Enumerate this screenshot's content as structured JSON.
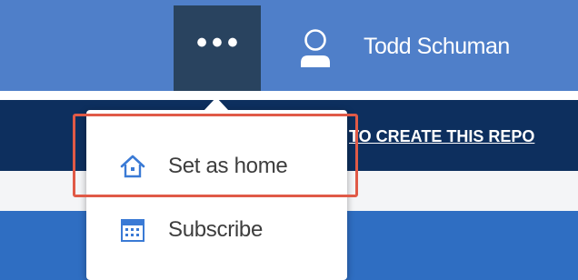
{
  "header": {
    "more_label": "•••",
    "user_name": "Todd Schuman"
  },
  "banner": {
    "link_text": "TO CREATE THIS REPO"
  },
  "menu": {
    "items": [
      {
        "label": "Set as home",
        "icon": "home-icon"
      },
      {
        "label": "Subscribe",
        "icon": "calendar-icon"
      }
    ]
  },
  "colors": {
    "topbar": "#4f7fc9",
    "more_button": "#29435f",
    "banner": "#0d2f5e",
    "lower_bar": "#2f6ec2",
    "highlight": "#e05a47",
    "icon_accent": "#3a7ad5"
  }
}
